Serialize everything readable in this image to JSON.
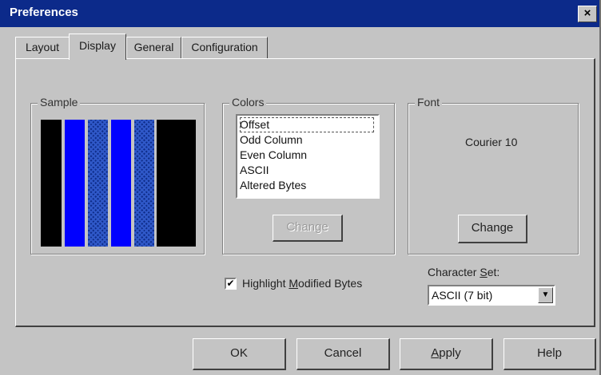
{
  "window": {
    "title": "Preferences",
    "close_glyph": "×"
  },
  "tabs": [
    {
      "label": "Layout",
      "active": false
    },
    {
      "label": "Display",
      "active": true
    },
    {
      "label": "General",
      "active": false
    },
    {
      "label": "Configuration",
      "active": false
    }
  ],
  "sample": {
    "label": "Sample",
    "bars": [
      "solid-black",
      "solid-blue",
      "checkered-blue",
      "solid-blue",
      "checkered-blue",
      "solid-black"
    ],
    "colors": {
      "black": "#000000",
      "blue": "#0000ff",
      "checker": "#0f2d8a"
    }
  },
  "colors_group": {
    "label": "Colors",
    "items": [
      "Offset",
      "Odd Column",
      "Even Column",
      "ASCII",
      "Altered Bytes"
    ],
    "selected_item": "Offset",
    "change_button": "Change",
    "change_enabled": false
  },
  "font_group": {
    "label": "Font",
    "font_name": "Courier 10",
    "change_button": "Change"
  },
  "highlight": {
    "checked": true,
    "check_glyph": "✔",
    "label_pre": "Highlight ",
    "label_mnemonic": "M",
    "label_post": "odified Bytes"
  },
  "charset": {
    "label_pre": "Character ",
    "label_mnemonic": "S",
    "label_post": "et:",
    "value": "ASCII (7 bit)",
    "dropdown_glyph": "▼"
  },
  "footer": {
    "ok": "OK",
    "cancel": "Cancel",
    "apply_mnemonic": "A",
    "apply_rest": "pply",
    "help": "Help"
  },
  "theme": {
    "titlebar": "#0c2a8a",
    "face": "#c4c4c4"
  }
}
